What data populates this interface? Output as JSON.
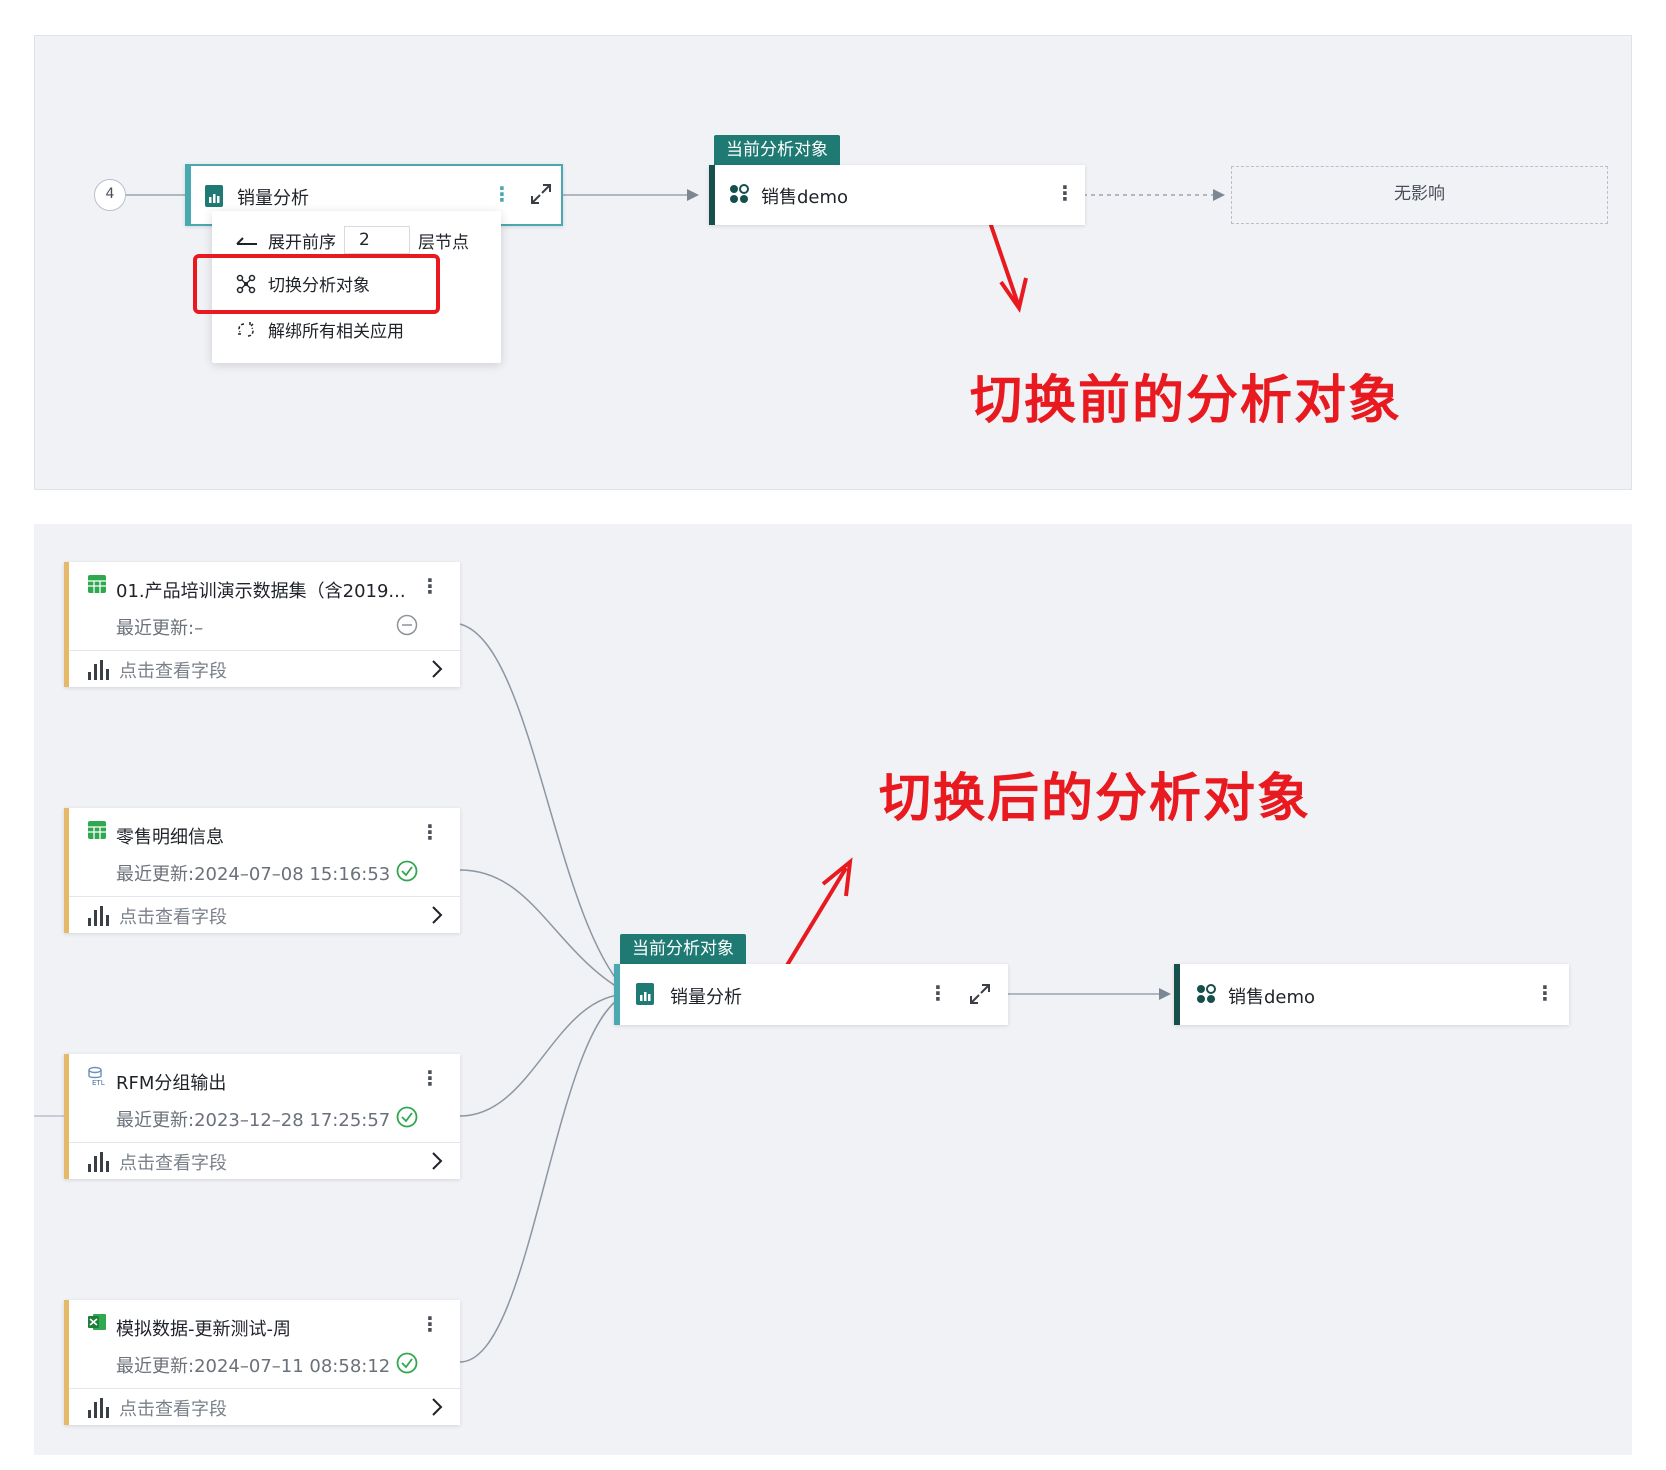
{
  "top": {
    "level_badge": "4",
    "source_node": {
      "label": "销量分析",
      "icon": "chart-report-icon"
    },
    "menu": {
      "expand_prefix": "展开前序",
      "expand_value": "2",
      "expand_suffix": "层节点",
      "switch_label": "切换分析对象",
      "unbind_label": "解绑所有相关应用"
    },
    "current_tag": "当前分析对象",
    "target_node": {
      "label": "销售demo",
      "icon": "dashboard-app-icon"
    },
    "no_impact_label": "无影响",
    "annotation": "切换前的分析对象"
  },
  "bottom": {
    "datasets": [
      {
        "title": "01.产品培训演示数据集（含2019...",
        "updated": "最近更新:–",
        "fields": "点击查看字段",
        "icon": "csv-table-icon",
        "status": "none-icon"
      },
      {
        "title": "零售明细信息",
        "updated": "最近更新:2024–07–08 15:16:53",
        "fields": "点击查看字段",
        "icon": "csv-table-icon",
        "status": "check-circle-icon"
      },
      {
        "title": "RFM分组输出",
        "updated": "最近更新:2023–12–28 17:25:57",
        "fields": "点击查看字段",
        "icon": "etl-icon",
        "status": "check-circle-icon"
      },
      {
        "title": "模拟数据-更新测试-周",
        "updated": "最近更新:2024–07–11 08:58:12",
        "fields": "点击查看字段",
        "icon": "excel-icon",
        "status": "check-circle-icon"
      }
    ],
    "current_tag": "当前分析对象",
    "current_node": {
      "label": "销量分析",
      "icon": "chart-report-icon"
    },
    "target_node": {
      "label": "销售demo",
      "icon": "dashboard-app-icon"
    },
    "annotation": "切换后的分析对象"
  },
  "colors": {
    "accent_teal": "#1f7a74",
    "card_stripe": "#e6b96a",
    "annotation_red": "#e8191f",
    "success_green": "#2fa84f"
  }
}
